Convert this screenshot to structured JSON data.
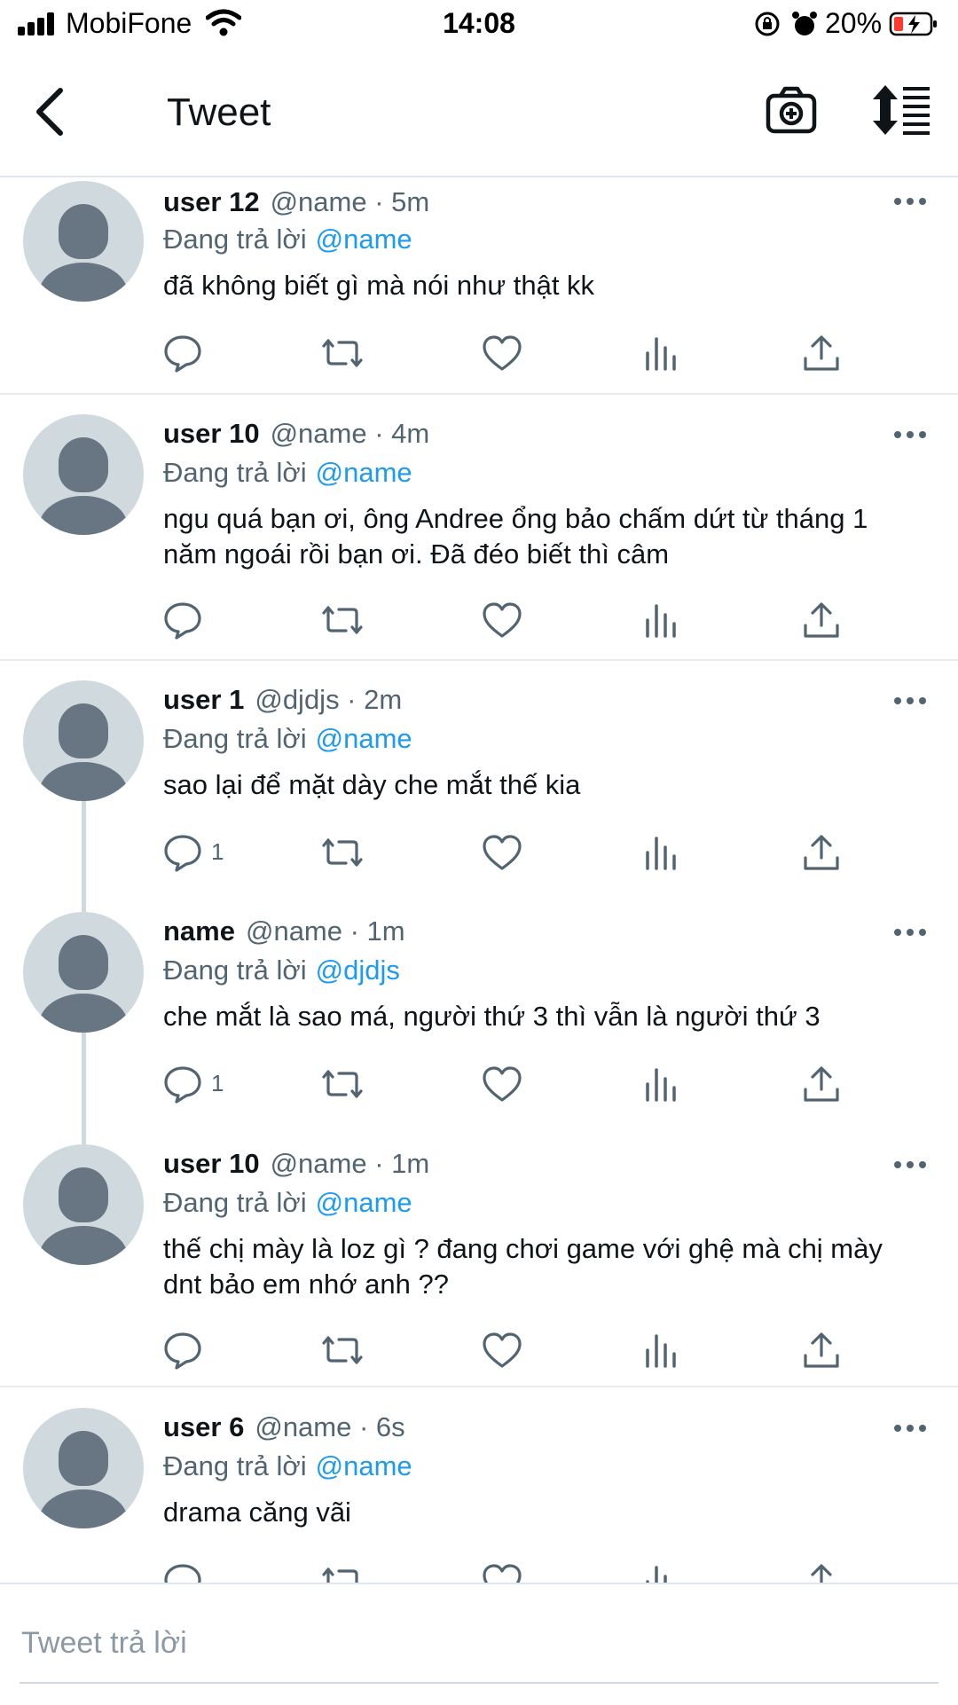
{
  "status_bar": {
    "carrier": "MobiFone",
    "time": "14:08",
    "battery": "20%"
  },
  "header": {
    "title": "Tweet"
  },
  "tweets": [
    {
      "name": "user 12",
      "handle": "@name · 5m",
      "reply_prefix": "Đang trả lời",
      "reply_to": "@name",
      "text": "đã không biết gì mà nói như thật kk",
      "reply_count": ""
    },
    {
      "name": "user 10",
      "handle": "@name · 4m",
      "reply_prefix": "Đang trả lời",
      "reply_to": "@name",
      "text": "ngu quá bạn ơi, ông Andree ổng bảo chấm dứt từ tháng 1 năm ngoái rồi bạn ơi. Đã đéo biết thì câm",
      "reply_count": ""
    },
    {
      "name": "user 1",
      "handle": "@djdjs · 2m",
      "reply_prefix": "Đang trả lời",
      "reply_to": "@name",
      "text": "sao lại để mặt dày che mắt thế kia",
      "reply_count": "1"
    },
    {
      "name": "name",
      "handle": "@name · 1m",
      "reply_prefix": "Đang trả lời",
      "reply_to": "@djdjs",
      "text": "che mắt là sao má, người thứ 3 thì vẫn là người thứ 3",
      "reply_count": "1"
    },
    {
      "name": "user 10",
      "handle": "@name · 1m",
      "reply_prefix": "Đang trả lời",
      "reply_to": "@name",
      "text": "thế chị mày là loz gì ? đang chơi game với ghệ mà chị mày dnt bảo em nhớ anh ??",
      "reply_count": ""
    },
    {
      "name": "user 6",
      "handle": "@name · 6s",
      "reply_prefix": "Đang trả lời",
      "reply_to": "@name",
      "text": "drama căng vãi",
      "reply_count": ""
    }
  ],
  "composer": {
    "placeholder": "Tweet trả lời"
  },
  "colors": {
    "link": "#1d9bf0",
    "secondary_text": "#536471",
    "avatar_bg": "#cfd9de",
    "avatar_fg": "#687684"
  }
}
